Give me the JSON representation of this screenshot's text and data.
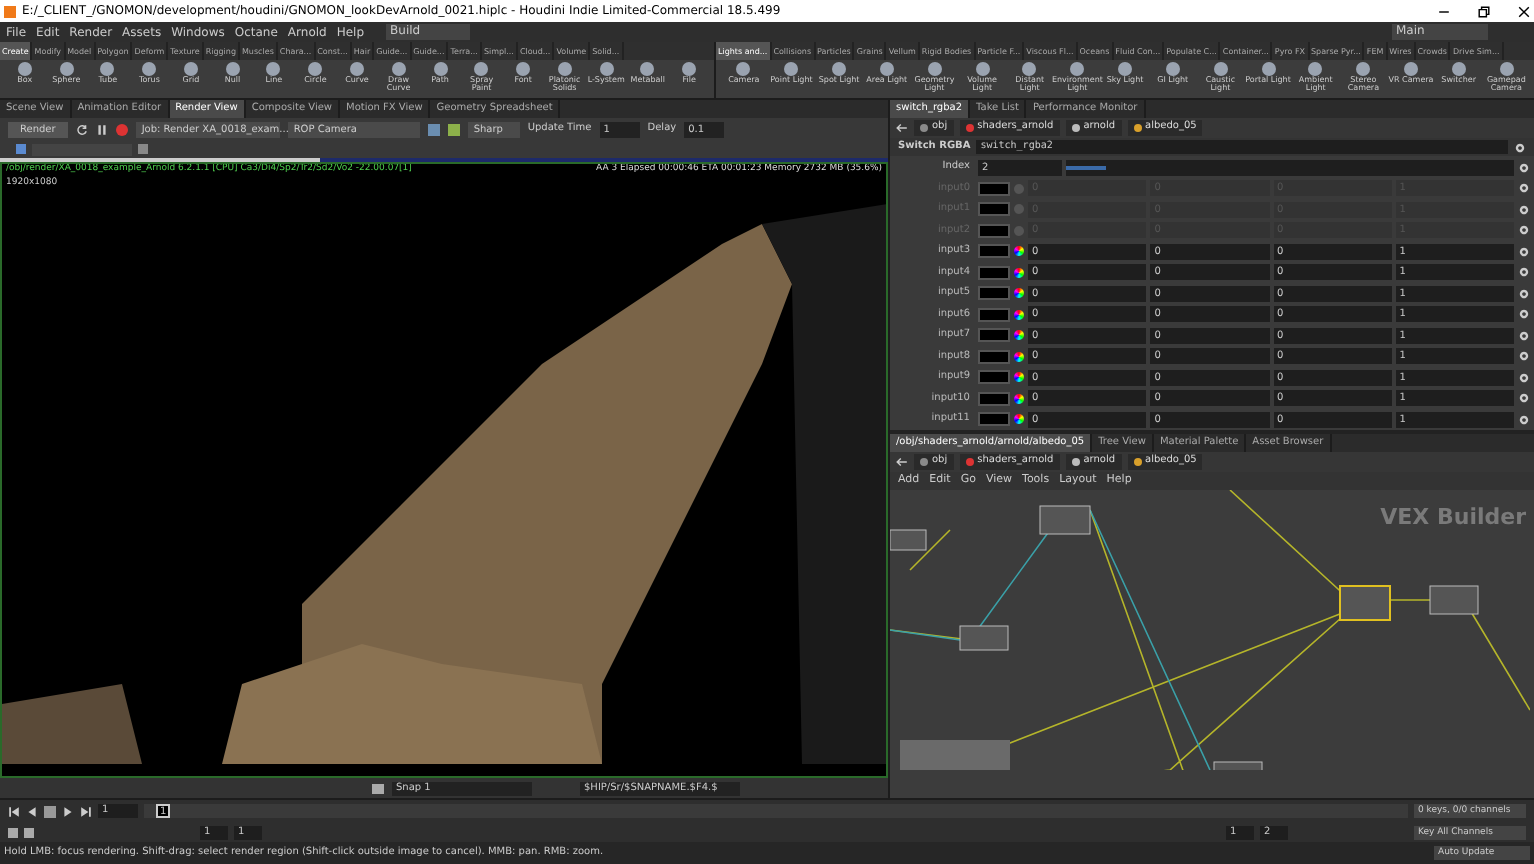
{
  "window": {
    "title": "E:/_CLIENT_/GNOMON/development/houdini/GNOMON_lookDevArnold_0021.hiplc - Houdini Indie Limited-Commercial 18.5.499"
  },
  "menu": [
    "File",
    "Edit",
    "Render",
    "Assets",
    "Windows",
    "Octane",
    "Arnold",
    "Help"
  ],
  "desktops": [
    {
      "label": "Build"
    },
    {
      "label": "Main"
    }
  ],
  "shelf_left": {
    "tabs": [
      {
        "label": "Create",
        "selected": true
      },
      {
        "label": "Modify",
        "selected": false
      },
      {
        "label": "Model",
        "selected": false
      },
      {
        "label": "Polygon",
        "selected": false
      },
      {
        "label": "Deform",
        "selected": false
      },
      {
        "label": "Texture",
        "selected": false
      },
      {
        "label": "Rigging",
        "selected": false
      },
      {
        "label": "Muscles",
        "selected": false
      },
      {
        "label": "Chara...",
        "selected": false
      },
      {
        "label": "Const...",
        "selected": false
      },
      {
        "label": "Hair",
        "selected": false
      },
      {
        "label": "Guide...",
        "selected": false
      },
      {
        "label": "Guide...",
        "selected": false
      },
      {
        "label": "Terra...",
        "selected": false
      },
      {
        "label": "Simpl...",
        "selected": false
      },
      {
        "label": "Cloud...",
        "selected": false
      },
      {
        "label": "Volume",
        "selected": false
      },
      {
        "label": "Solid...",
        "selected": false
      }
    ],
    "tools": [
      "Box",
      "Sphere",
      "Tube",
      "Torus",
      "Grid",
      "Null",
      "Line",
      "Circle",
      "Curve",
      "Draw Curve",
      "Path",
      "Spray Paint",
      "Font",
      "Platonic Solids",
      "L-System",
      "Metaball",
      "File"
    ]
  },
  "shelf_right": {
    "tabs": [
      {
        "label": "Lights and...",
        "selected": true
      },
      {
        "label": "Collisions",
        "selected": false
      },
      {
        "label": "Particles",
        "selected": false
      },
      {
        "label": "Grains",
        "selected": false
      },
      {
        "label": "Vellum",
        "selected": false
      },
      {
        "label": "Rigid Bodies",
        "selected": false
      },
      {
        "label": "Particle F...",
        "selected": false
      },
      {
        "label": "Viscous Fl...",
        "selected": false
      },
      {
        "label": "Oceans",
        "selected": false
      },
      {
        "label": "Fluid Con...",
        "selected": false
      },
      {
        "label": "Populate C...",
        "selected": false
      },
      {
        "label": "Container...",
        "selected": false
      },
      {
        "label": "Pyro FX",
        "selected": false
      },
      {
        "label": "Sparse Pyr...",
        "selected": false
      },
      {
        "label": "FEM",
        "selected": false
      },
      {
        "label": "Wires",
        "selected": false
      },
      {
        "label": "Crowds",
        "selected": false
      },
      {
        "label": "Drive Sim...",
        "selected": false
      }
    ],
    "tools": [
      "Camera",
      "Point Light",
      "Spot Light",
      "Area Light",
      "Geometry Light",
      "Volume Light",
      "Distant Light",
      "Environment Light",
      "Sky Light",
      "GI Light",
      "Caustic Light",
      "Portal Light",
      "Ambient Light",
      "Stereo Camera",
      "VR Camera",
      "Switcher",
      "Gamepad Camera"
    ]
  },
  "left_pane": {
    "tabs": [
      {
        "label": "Scene View",
        "selected": false
      },
      {
        "label": "Animation Editor",
        "selected": false
      },
      {
        "label": "Render View",
        "selected": true
      },
      {
        "label": "Composite View",
        "selected": false
      },
      {
        "label": "Motion FX View",
        "selected": false
      },
      {
        "label": "Geometry Spreadsheet",
        "selected": false
      }
    ],
    "render_button": "Render",
    "job": "Job: Render XA_0018_exam...",
    "camera": "ROP Camera",
    "quality": "Sharp",
    "update_time_label": "Update Time",
    "update_time": "1",
    "delay_label": "Delay",
    "delay": "0.1",
    "progress": {
      "level": 0.36
    },
    "render_info": "/obj/render/XA_0018_example_Arnold 6.2.1.1 [CPU] Ca3/Di4/Sp2/Tr2/Sd2/Vo2 -22.00.07[1]",
    "render_stats": "AA 3  Elapsed 00:00:46  ETA 00:01:23  Memory 2732 MB (35.6%)",
    "resolution": "1920x1080",
    "snapshot": "Snap 1",
    "output_path": "$HIP/Sr/$SNAPNAME.$F4.$"
  },
  "param_pane": {
    "tabs": [
      {
        "label": "switch_rgba2",
        "selected": true
      },
      {
        "label": "Take List",
        "selected": false
      },
      {
        "label": "Performance Monitor",
        "selected": false
      }
    ],
    "path": [
      "obj",
      "shaders_arnold",
      "arnold",
      "albedo_05"
    ],
    "node_type": "Switch RGBA",
    "node_name": "switch_rgba2",
    "index": {
      "label": "Index",
      "value": "2",
      "level": 0.09
    },
    "inputs": [
      {
        "label": "input0",
        "disabled": true,
        "values": [
          "0",
          "0",
          "0",
          "1"
        ]
      },
      {
        "label": "input1",
        "disabled": true,
        "values": [
          "0",
          "0",
          "0",
          "1"
        ]
      },
      {
        "label": "input2",
        "disabled": true,
        "values": [
          "0",
          "0",
          "0",
          "1"
        ]
      },
      {
        "label": "input3",
        "disabled": false,
        "values": [
          "0",
          "0",
          "0",
          "1"
        ]
      },
      {
        "label": "input4",
        "disabled": false,
        "values": [
          "0",
          "0",
          "0",
          "1"
        ]
      },
      {
        "label": "input5",
        "disabled": false,
        "values": [
          "0",
          "0",
          "0",
          "1"
        ]
      },
      {
        "label": "input6",
        "disabled": false,
        "values": [
          "0",
          "0",
          "0",
          "1"
        ]
      },
      {
        "label": "input7",
        "disabled": false,
        "values": [
          "0",
          "0",
          "0",
          "1"
        ]
      },
      {
        "label": "input8",
        "disabled": false,
        "values": [
          "0",
          "0",
          "0",
          "1"
        ]
      },
      {
        "label": "input9",
        "disabled": false,
        "values": [
          "0",
          "0",
          "0",
          "1"
        ]
      },
      {
        "label": "input10",
        "disabled": false,
        "values": [
          "0",
          "0",
          "0",
          "1"
        ]
      },
      {
        "label": "input11",
        "disabled": false,
        "values": [
          "0",
          "0",
          "0",
          "1"
        ]
      }
    ]
  },
  "network_pane": {
    "tabs": [
      {
        "label": "/obj/shaders_arnold/arnold/albedo_05",
        "selected": true
      },
      {
        "label": "Tree View",
        "selected": false
      },
      {
        "label": "Material Palette",
        "selected": false
      },
      {
        "label": "Asset Browser",
        "selected": false
      }
    ],
    "path": [
      "obj",
      "shaders_arnold",
      "arnold",
      "albedo_05"
    ],
    "menu": [
      "Add",
      "Edit",
      "Go",
      "View",
      "Tools",
      "Layout",
      "Help"
    ],
    "context_label": "VEX Builder"
  },
  "playbar": {
    "frame": "1",
    "marker_frame": "1",
    "start": "1",
    "end": "1",
    "range_start": "1",
    "range_end": "2",
    "keys": "0 keys, 0/0 channels",
    "key_all": "Key All Channels",
    "auto_update": "Auto Update"
  },
  "status_bar": "Hold LMB: focus rendering. Shift-drag: select render region (Shift-click outside image to cancel). MMB: pan. RMB: zoom."
}
